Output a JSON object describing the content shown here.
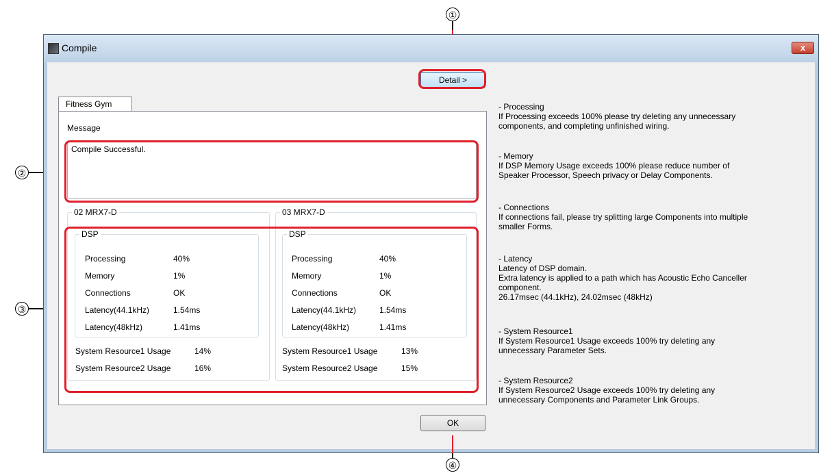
{
  "window": {
    "title": "Compile",
    "close_label": "x",
    "detail_button": "Detail >",
    "ok_button": "OK",
    "tab_label": "Fitness Gym",
    "message_label": "Message",
    "message_text": "Compile Successful."
  },
  "units": [
    {
      "name": "02 MRX7-D",
      "dsp_label": "DSP",
      "rows": [
        {
          "label": "Processing",
          "value": "40%"
        },
        {
          "label": "Memory",
          "value": "1%"
        },
        {
          "label": "Connections",
          "value": "OK"
        },
        {
          "label": "Latency(44.1kHz)",
          "value": "1.54ms"
        },
        {
          "label": "Latency(48kHz)",
          "value": "1.41ms"
        }
      ],
      "resource1": {
        "label": "System Resource1 Usage",
        "value": "14%"
      },
      "resource2": {
        "label": "System Resource2 Usage",
        "value": "16%"
      }
    },
    {
      "name": "03 MRX7-D",
      "dsp_label": "DSP",
      "rows": [
        {
          "label": "Processing",
          "value": "40%"
        },
        {
          "label": "Memory",
          "value": "1%"
        },
        {
          "label": "Connections",
          "value": "OK"
        },
        {
          "label": "Latency(44.1kHz)",
          "value": "1.54ms"
        },
        {
          "label": "Latency(48kHz)",
          "value": "1.41ms"
        }
      ],
      "resource1": {
        "label": "System Resource1 Usage",
        "value": "13%"
      },
      "resource2": {
        "label": "System Resource2 Usage",
        "value": "15%"
      }
    }
  ],
  "help": [
    {
      "lines": [
        "- Processing",
        "If Processing exceeds 100% please try deleting any unnecessary",
        "components, and completing unfinished wiring."
      ]
    },
    {
      "lines": [
        "- Memory",
        "If DSP Memory Usage exceeds 100% please reduce number of",
        "Speaker Processor, Speech privacy or Delay Components."
      ]
    },
    {
      "lines": [
        "- Connections",
        "If connections fail, please try splitting large Components into multiple",
        "smaller Forms."
      ]
    },
    {
      "lines": [
        "- Latency",
        "Latency of DSP domain.",
        "Extra latency is applied to a path which has Acoustic Echo Canceller",
        "component.",
        "26.17msec (44.1kHz), 24.02msec (48kHz)"
      ]
    },
    {
      "lines": [
        "- System Resource1",
        "If System Resource1 Usage exceeds 100%  try deleting  any",
        "unnecessary Parameter Sets."
      ]
    },
    {
      "lines": [
        "- System Resource2",
        "If System Resource2 Usage exceeds 100% try deleting  any",
        "unnecessary Components and Parameter Link Groups."
      ]
    }
  ],
  "callouts": [
    "①",
    "②",
    "③",
    "④"
  ],
  "colors": {
    "highlight": "#e0202a",
    "title_gradient_top": "#dbe8f5",
    "default_button": "#bfe0f7"
  }
}
